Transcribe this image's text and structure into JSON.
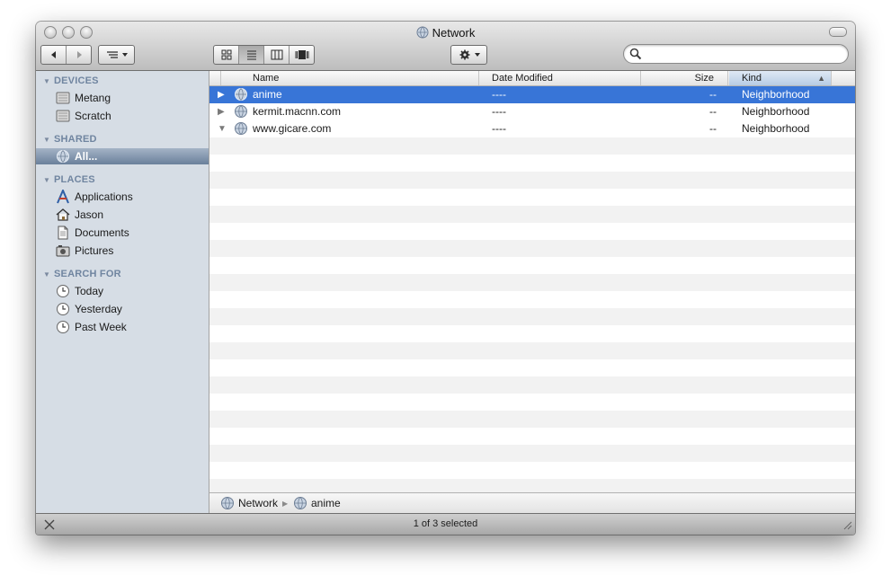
{
  "window": {
    "title": "Network"
  },
  "toolbar": {
    "view_buttons": [
      "icon-view",
      "list-view",
      "column-view",
      "coverflow-view"
    ],
    "selected_view": "list-view",
    "search": {
      "value": "",
      "placeholder": ""
    }
  },
  "sidebar": {
    "sections": [
      {
        "label": "DEVICES",
        "items": [
          {
            "label": "Metang",
            "icon": "disk-icon"
          },
          {
            "label": "Scratch",
            "icon": "disk-icon"
          }
        ]
      },
      {
        "label": "SHARED",
        "items": [
          {
            "label": "All...",
            "icon": "network-globe-icon",
            "selected": true
          }
        ]
      },
      {
        "label": "PLACES",
        "items": [
          {
            "label": "Applications",
            "icon": "applications-icon"
          },
          {
            "label": "Jason",
            "icon": "home-icon"
          },
          {
            "label": "Documents",
            "icon": "documents-icon"
          },
          {
            "label": "Pictures",
            "icon": "pictures-icon"
          }
        ]
      },
      {
        "label": "SEARCH FOR",
        "items": [
          {
            "label": "Today",
            "icon": "clock-icon"
          },
          {
            "label": "Yesterday",
            "icon": "clock-icon"
          },
          {
            "label": "Past Week",
            "icon": "clock-icon"
          }
        ]
      }
    ]
  },
  "list": {
    "columns": {
      "name": "Name",
      "date": "Date Modified",
      "size": "Size",
      "kind": "Kind"
    },
    "sorted_by": "Kind",
    "rows": [
      {
        "name": "anime",
        "date": "----",
        "size": "--",
        "kind": "Neighborhood",
        "selected": true,
        "expanded": false
      },
      {
        "name": "kermit.macnn.com",
        "date": "----",
        "size": "--",
        "kind": "Neighborhood",
        "selected": false,
        "expanded": false
      },
      {
        "name": "www.gicare.com",
        "date": "----",
        "size": "--",
        "kind": "Neighborhood",
        "selected": false,
        "expanded": true
      }
    ]
  },
  "pathbar": {
    "items": [
      "Network",
      "anime"
    ]
  },
  "status": {
    "text": "1 of 3 selected"
  },
  "colors": {
    "selection": "#3875d7",
    "sidebar_bg": "#d6dde5",
    "sidebar_selection": "#6a809b",
    "section_header": "#7085a0",
    "alt_row": "#f2f2f2"
  }
}
